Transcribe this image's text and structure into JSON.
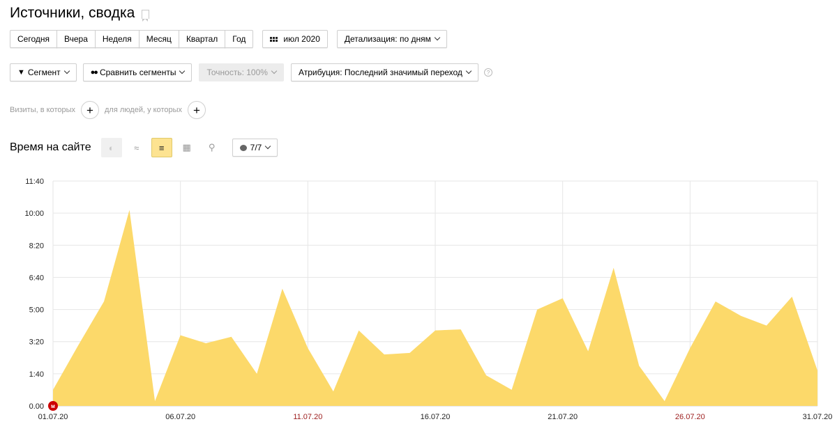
{
  "header": {
    "title": "Источники, сводка"
  },
  "period_buttons": [
    "Сегодня",
    "Вчера",
    "Неделя",
    "Месяц",
    "Квартал",
    "Год"
  ],
  "date_picker": {
    "label": "июл 2020"
  },
  "detail_select": {
    "label": "Детализация: по дням"
  },
  "filters": {
    "segment": "Сегмент",
    "compare": "Сравнить сегменты",
    "accuracy": "Точность: 100%",
    "attribution": "Атрибуция: Последний значимый переход",
    "help": "?"
  },
  "conditions": {
    "visits_label": "Визиты, в которых",
    "people_label": "для людей, у которых",
    "plus": "+"
  },
  "chart_toolbar": {
    "title": "Время на сайте",
    "series_count": "7/7"
  },
  "colors": {
    "fill": "#fcd96a",
    "grid": "#e6e6e6",
    "active_tool": "#fde391",
    "weekend_label": "#9b1b1b",
    "marker": "#cc0000"
  },
  "chart_data": {
    "type": "area",
    "title": "Время на сайте",
    "x": [
      "01.07.20",
      "02.07.20",
      "03.07.20",
      "04.07.20",
      "05.07.20",
      "06.07.20",
      "07.07.20",
      "08.07.20",
      "09.07.20",
      "10.07.20",
      "11.07.20",
      "12.07.20",
      "13.07.20",
      "14.07.20",
      "15.07.20",
      "16.07.20",
      "17.07.20",
      "18.07.20",
      "19.07.20",
      "20.07.20",
      "21.07.20",
      "22.07.20",
      "23.07.20",
      "24.07.20",
      "25.07.20",
      "26.07.20",
      "27.07.20",
      "28.07.20",
      "29.07.20",
      "30.07.20",
      "31.07.20"
    ],
    "values": [
      50,
      190,
      325,
      610,
      15,
      220,
      195,
      215,
      100,
      365,
      180,
      45,
      235,
      160,
      165,
      235,
      238,
      95,
      50,
      300,
      335,
      170,
      430,
      125,
      15,
      180,
      325,
      280,
      250,
      340,
      110
    ],
    "ylim": [
      0,
      700
    ],
    "yticks": [
      0,
      100,
      200,
      300,
      400,
      500,
      600,
      700
    ],
    "ytick_labels": [
      "0.00",
      "1:40",
      "3:20",
      "5:00",
      "6:40",
      "8:20",
      "10:00",
      "11:40"
    ],
    "xtick_labels": [
      {
        "label": "01.07.20",
        "index": 0,
        "weekend": false
      },
      {
        "label": "06.07.20",
        "index": 5,
        "weekend": false
      },
      {
        "label": "11.07.20",
        "index": 10,
        "weekend": true
      },
      {
        "label": "16.07.20",
        "index": 15,
        "weekend": false
      },
      {
        "label": "21.07.20",
        "index": 20,
        "weekend": false
      },
      {
        "label": "26.07.20",
        "index": 25,
        "weekend": true
      },
      {
        "label": "31.07.20",
        "index": 30,
        "weekend": false
      }
    ],
    "annotation": {
      "label": "м",
      "index": 0
    },
    "grid": true
  }
}
